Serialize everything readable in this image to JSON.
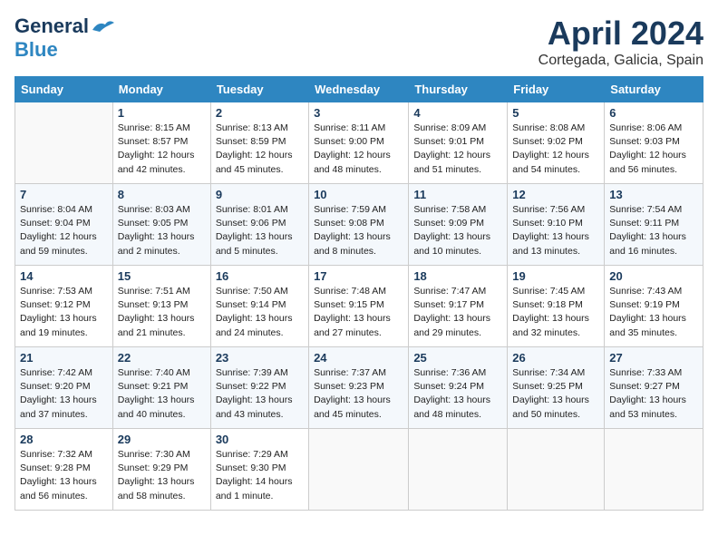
{
  "header": {
    "logo_general": "General",
    "logo_blue": "Blue",
    "month_title": "April 2024",
    "location": "Cortegada, Galicia, Spain"
  },
  "calendar": {
    "days_of_week": [
      "Sunday",
      "Monday",
      "Tuesday",
      "Wednesday",
      "Thursday",
      "Friday",
      "Saturday"
    ],
    "weeks": [
      [
        {
          "day": "",
          "detail": ""
        },
        {
          "day": "1",
          "detail": "Sunrise: 8:15 AM\nSunset: 8:57 PM\nDaylight: 12 hours\nand 42 minutes."
        },
        {
          "day": "2",
          "detail": "Sunrise: 8:13 AM\nSunset: 8:59 PM\nDaylight: 12 hours\nand 45 minutes."
        },
        {
          "day": "3",
          "detail": "Sunrise: 8:11 AM\nSunset: 9:00 PM\nDaylight: 12 hours\nand 48 minutes."
        },
        {
          "day": "4",
          "detail": "Sunrise: 8:09 AM\nSunset: 9:01 PM\nDaylight: 12 hours\nand 51 minutes."
        },
        {
          "day": "5",
          "detail": "Sunrise: 8:08 AM\nSunset: 9:02 PM\nDaylight: 12 hours\nand 54 minutes."
        },
        {
          "day": "6",
          "detail": "Sunrise: 8:06 AM\nSunset: 9:03 PM\nDaylight: 12 hours\nand 56 minutes."
        }
      ],
      [
        {
          "day": "7",
          "detail": "Sunrise: 8:04 AM\nSunset: 9:04 PM\nDaylight: 12 hours\nand 59 minutes."
        },
        {
          "day": "8",
          "detail": "Sunrise: 8:03 AM\nSunset: 9:05 PM\nDaylight: 13 hours\nand 2 minutes."
        },
        {
          "day": "9",
          "detail": "Sunrise: 8:01 AM\nSunset: 9:06 PM\nDaylight: 13 hours\nand 5 minutes."
        },
        {
          "day": "10",
          "detail": "Sunrise: 7:59 AM\nSunset: 9:08 PM\nDaylight: 13 hours\nand 8 minutes."
        },
        {
          "day": "11",
          "detail": "Sunrise: 7:58 AM\nSunset: 9:09 PM\nDaylight: 13 hours\nand 10 minutes."
        },
        {
          "day": "12",
          "detail": "Sunrise: 7:56 AM\nSunset: 9:10 PM\nDaylight: 13 hours\nand 13 minutes."
        },
        {
          "day": "13",
          "detail": "Sunrise: 7:54 AM\nSunset: 9:11 PM\nDaylight: 13 hours\nand 16 minutes."
        }
      ],
      [
        {
          "day": "14",
          "detail": "Sunrise: 7:53 AM\nSunset: 9:12 PM\nDaylight: 13 hours\nand 19 minutes."
        },
        {
          "day": "15",
          "detail": "Sunrise: 7:51 AM\nSunset: 9:13 PM\nDaylight: 13 hours\nand 21 minutes."
        },
        {
          "day": "16",
          "detail": "Sunrise: 7:50 AM\nSunset: 9:14 PM\nDaylight: 13 hours\nand 24 minutes."
        },
        {
          "day": "17",
          "detail": "Sunrise: 7:48 AM\nSunset: 9:15 PM\nDaylight: 13 hours\nand 27 minutes."
        },
        {
          "day": "18",
          "detail": "Sunrise: 7:47 AM\nSunset: 9:17 PM\nDaylight: 13 hours\nand 29 minutes."
        },
        {
          "day": "19",
          "detail": "Sunrise: 7:45 AM\nSunset: 9:18 PM\nDaylight: 13 hours\nand 32 minutes."
        },
        {
          "day": "20",
          "detail": "Sunrise: 7:43 AM\nSunset: 9:19 PM\nDaylight: 13 hours\nand 35 minutes."
        }
      ],
      [
        {
          "day": "21",
          "detail": "Sunrise: 7:42 AM\nSunset: 9:20 PM\nDaylight: 13 hours\nand 37 minutes."
        },
        {
          "day": "22",
          "detail": "Sunrise: 7:40 AM\nSunset: 9:21 PM\nDaylight: 13 hours\nand 40 minutes."
        },
        {
          "day": "23",
          "detail": "Sunrise: 7:39 AM\nSunset: 9:22 PM\nDaylight: 13 hours\nand 43 minutes."
        },
        {
          "day": "24",
          "detail": "Sunrise: 7:37 AM\nSunset: 9:23 PM\nDaylight: 13 hours\nand 45 minutes."
        },
        {
          "day": "25",
          "detail": "Sunrise: 7:36 AM\nSunset: 9:24 PM\nDaylight: 13 hours\nand 48 minutes."
        },
        {
          "day": "26",
          "detail": "Sunrise: 7:34 AM\nSunset: 9:25 PM\nDaylight: 13 hours\nand 50 minutes."
        },
        {
          "day": "27",
          "detail": "Sunrise: 7:33 AM\nSunset: 9:27 PM\nDaylight: 13 hours\nand 53 minutes."
        }
      ],
      [
        {
          "day": "28",
          "detail": "Sunrise: 7:32 AM\nSunset: 9:28 PM\nDaylight: 13 hours\nand 56 minutes."
        },
        {
          "day": "29",
          "detail": "Sunrise: 7:30 AM\nSunset: 9:29 PM\nDaylight: 13 hours\nand 58 minutes."
        },
        {
          "day": "30",
          "detail": "Sunrise: 7:29 AM\nSunset: 9:30 PM\nDaylight: 14 hours\nand 1 minute."
        },
        {
          "day": "",
          "detail": ""
        },
        {
          "day": "",
          "detail": ""
        },
        {
          "day": "",
          "detail": ""
        },
        {
          "day": "",
          "detail": ""
        }
      ]
    ]
  }
}
